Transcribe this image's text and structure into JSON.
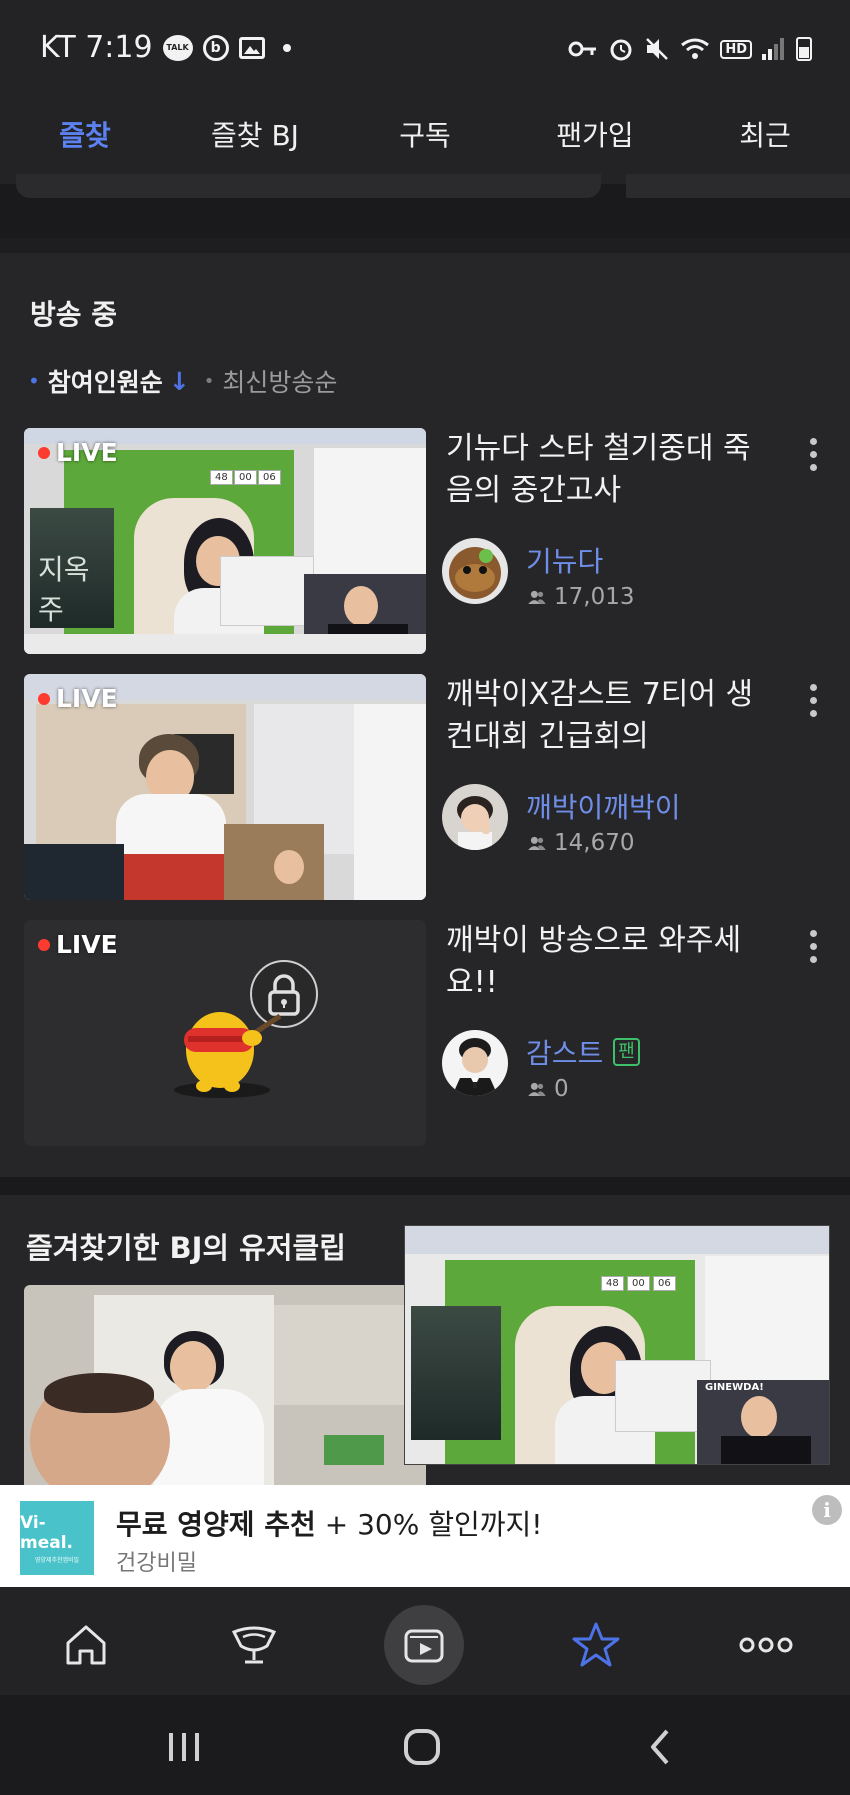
{
  "status_bar": {
    "carrier_time": "KT 7:19",
    "talk_label": "TALK",
    "b_label": "b",
    "hd_label": "HD"
  },
  "tabs": [
    {
      "label": "즐찾",
      "active": true
    },
    {
      "label": "즐찾 BJ",
      "active": false
    },
    {
      "label": "구독",
      "active": false
    },
    {
      "label": "팬가입",
      "active": false
    },
    {
      "label": "최근",
      "active": false
    }
  ],
  "live_section": {
    "title": "방송 중",
    "sort_active": "참여인원순",
    "sort_arrow": "↓",
    "sort_inactive": "최신방송순",
    "items": [
      {
        "badge": "LIVE",
        "title": "기뉴다 스타 철기중대 죽음의 중간고사",
        "bj": "기뉴다",
        "viewers": "17,013",
        "fan_badge": ""
      },
      {
        "badge": "LIVE",
        "title": "깨박이X감스트 7티어 생컨대회 긴급회의",
        "bj": "깨박이깨박이",
        "viewers": "14,670",
        "fan_badge": ""
      },
      {
        "badge": "LIVE",
        "title": "깨박이 방송으로 와주세요!!",
        "bj": "감스트",
        "viewers": "0",
        "fan_badge": "팬"
      }
    ]
  },
  "thumb_overlays": {
    "counter": [
      "48",
      "00",
      "06"
    ],
    "poster_text": "지옥주",
    "brand_tag": "GINEWDA!"
  },
  "clips_section": {
    "title": "즐겨찾기한 BJ의 유저클립"
  },
  "ad": {
    "logo_main": "Vi-meal.",
    "logo_sub": "영양제추천앱비밀",
    "title_bold": "무료 영양제 추천",
    "title_rest": " + 30% 할인까지!",
    "sponsor": "건강비밀",
    "info": "i"
  },
  "bottom_nav": [
    {
      "icon": "home-icon"
    },
    {
      "icon": "trophy-icon"
    },
    {
      "icon": "play-icon"
    },
    {
      "icon": "star-icon",
      "active": true
    },
    {
      "icon": "more-icon"
    }
  ],
  "colors": {
    "accent": "#4c74e8",
    "live_dot": "#ff3b30",
    "fan_green": "#3fbf6a",
    "bj_name": "#6f8ee8"
  }
}
